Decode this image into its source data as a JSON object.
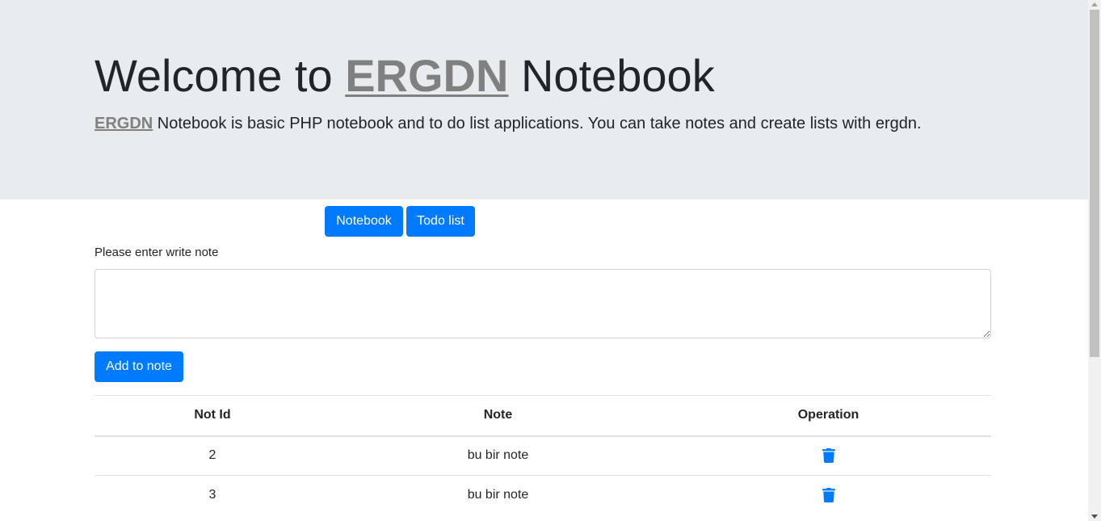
{
  "header": {
    "title_prefix": "Welcome to ",
    "brand": "ERGDN",
    "title_suffix": " Notebook",
    "lead_brand": "ERGDN",
    "lead_text": " Notebook is basic PHP notebook and to do list applications. You can take notes and create lists with ergdn."
  },
  "nav": {
    "notebook_label": "Notebook",
    "todo_label": "Todo list"
  },
  "form": {
    "label": "Please enter write note",
    "note_value": "",
    "submit_label": "Add to note"
  },
  "table": {
    "headers": [
      "Not Id",
      "Note",
      "Operation"
    ],
    "rows": [
      {
        "id": "2",
        "note": "bu bir note",
        "operation_icon": "trash-icon"
      },
      {
        "id": "3",
        "note": "bu bir note",
        "operation_icon": "trash-icon"
      }
    ]
  },
  "colors": {
    "primary": "#007bff",
    "jumbotron_bg": "#e9ecef",
    "brand_gray": "#808080"
  }
}
